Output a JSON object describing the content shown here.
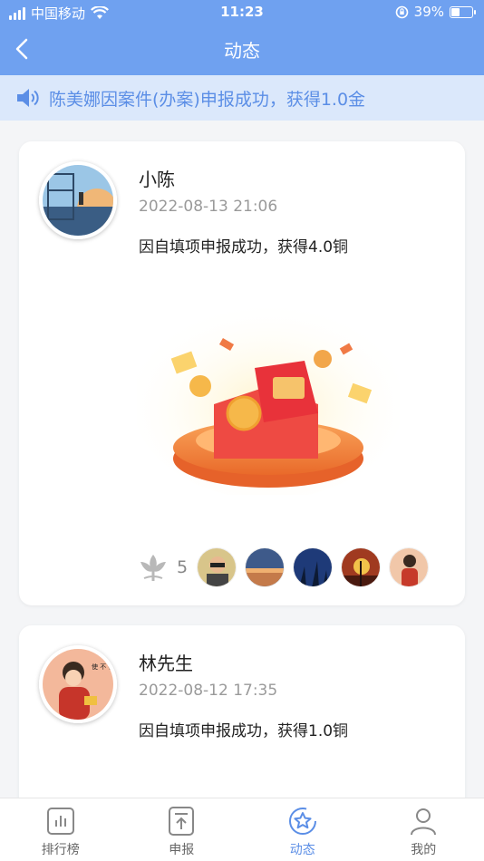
{
  "status": {
    "carrier": "中国移动",
    "time": "11:23",
    "battery": "39%",
    "battery_level": 0.39
  },
  "nav": {
    "title": "动态",
    "back_icon": "chevron-left-icon"
  },
  "notice": {
    "text": "陈美娜因案件(办案)申报成功，获得1.0金",
    "icon": "speaker-icon"
  },
  "posts": [
    {
      "name": "小陈",
      "time": "2022-08-13 21:06",
      "desc": "因自填项申报成功，获得4.0铜",
      "likes": "5"
    },
    {
      "name": "林先生",
      "time": "2022-08-12 17:35",
      "desc": "因自填项申报成功，获得1.0铜"
    }
  ],
  "tabs": [
    {
      "label": "排行榜",
      "icon": "chart-icon"
    },
    {
      "label": "申报",
      "icon": "report-icon"
    },
    {
      "label": "动态",
      "icon": "star-icon"
    },
    {
      "label": "我的",
      "icon": "user-icon"
    }
  ],
  "colors": {
    "accent": "#6fa1f0",
    "notice_bg": "#dbe8fb",
    "active_tab": "#5b8ee6"
  }
}
